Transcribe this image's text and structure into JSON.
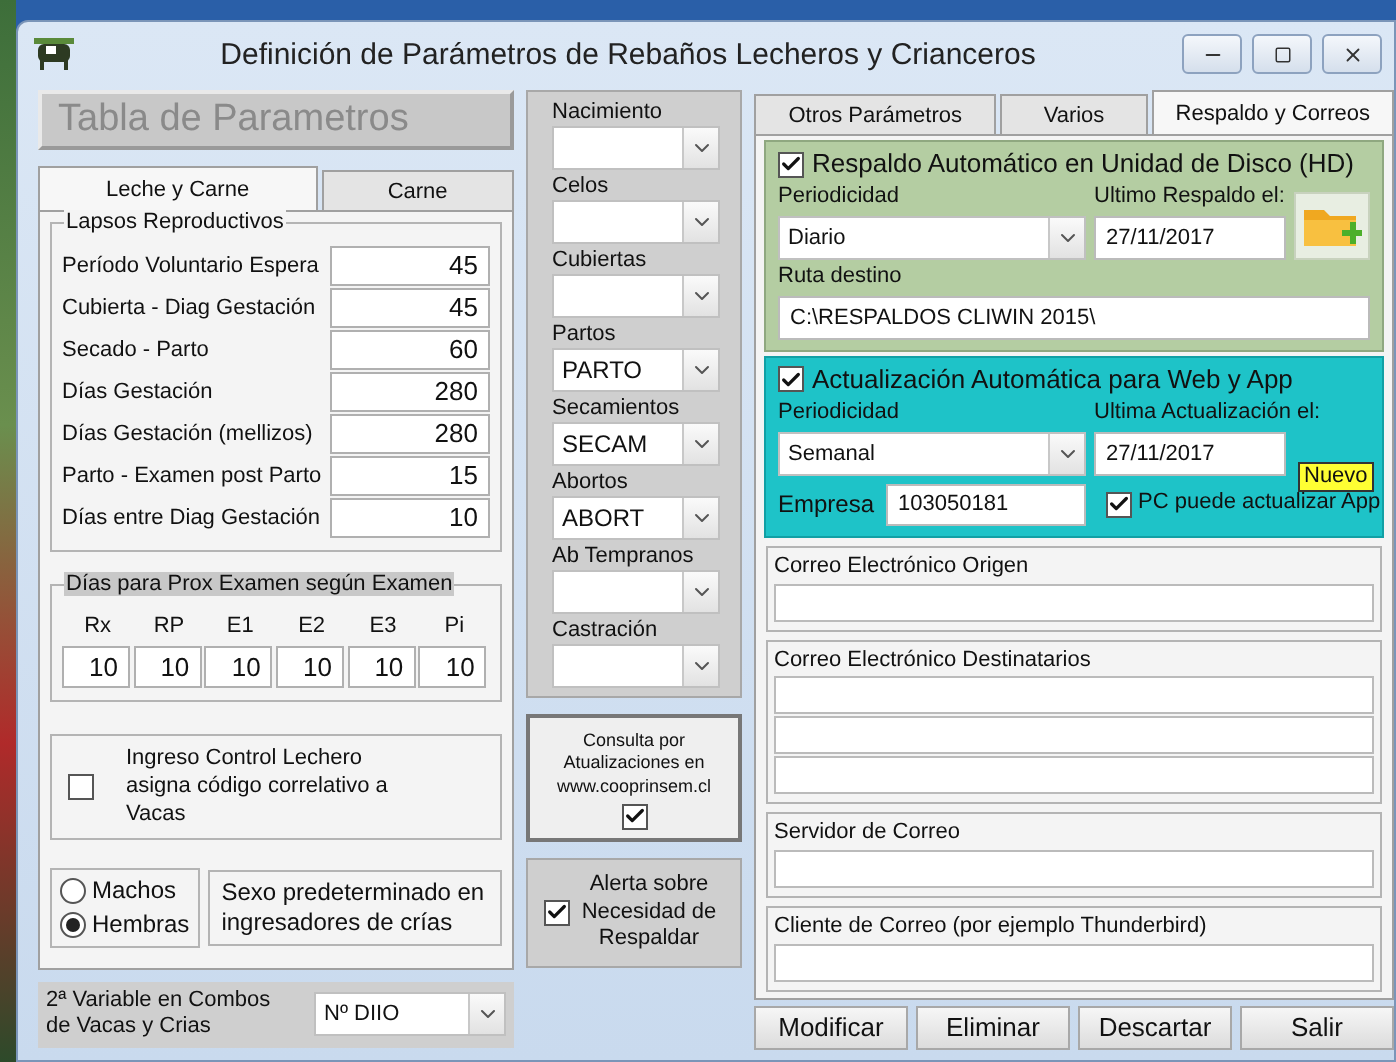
{
  "window": {
    "title": "Definición de Parámetros de Rebaños Lecheros y Crianceros"
  },
  "left": {
    "header": "Tabla de Parametros",
    "tabs": [
      {
        "label": "Leche y Carne",
        "selected": true
      },
      {
        "label": "Carne",
        "selected": false
      }
    ],
    "lapsos": {
      "title": "Lapsos Reproductivos",
      "rows": [
        {
          "label": "Período Voluntario Espera",
          "value": "45"
        },
        {
          "label": "Cubierta - Diag Gestación",
          "value": "45"
        },
        {
          "label": "Secado - Parto",
          "value": "60"
        },
        {
          "label": "Días Gestación",
          "value": "280"
        },
        {
          "label": "Días Gestación (mellizos)",
          "value": "280"
        },
        {
          "label": "Parto - Examen post Parto",
          "value": "15"
        },
        {
          "label": "Días entre Diag Gestación",
          "value": "10"
        }
      ]
    },
    "examen": {
      "title": "Días para Prox Examen según Examen",
      "columns": [
        {
          "label": "Rx",
          "value": "10"
        },
        {
          "label": "RP",
          "value": "10"
        },
        {
          "label": "E1",
          "value": "10"
        },
        {
          "label": "E2",
          "value": "10"
        },
        {
          "label": "E3",
          "value": "10"
        },
        {
          "label": "Pi",
          "value": "10"
        }
      ]
    },
    "ingreso": {
      "label": "Ingreso Control Lechero asigna código correlativo a Vacas",
      "checked": false
    },
    "sexo": {
      "options": [
        {
          "label": "Machos",
          "selected": false
        },
        {
          "label": "Hembras",
          "selected": true
        }
      ],
      "note": "Sexo predeterminado en ingresadores de crías"
    },
    "variable": {
      "label": "2ª Variable en Combos de Vacas y Crias",
      "value": "Nº DIIO"
    }
  },
  "middle": {
    "combos": [
      {
        "label": "Nacimiento"
      },
      {
        "label": "Celos"
      },
      {
        "label": "Cubiertas"
      },
      {
        "label": "Partos",
        "value": "PARTO"
      },
      {
        "label": "Secamientos",
        "value": "SECAM"
      },
      {
        "label": "Abortos",
        "value": "ABORT"
      },
      {
        "label": "Ab Tempranos"
      },
      {
        "label": "Castración"
      }
    ],
    "consulta": {
      "label": "Consulta por Atualizaciones en www.cooprinsem.cl",
      "checked": true
    },
    "alerta": {
      "label": "Alerta sobre Necesidad de Respaldar",
      "checked": true
    }
  },
  "right": {
    "tabs": [
      {
        "label": "Otros Parámetros",
        "selected": false
      },
      {
        "label": "Varios",
        "selected": false
      },
      {
        "label": "Respaldo y Correos",
        "selected": true
      }
    ],
    "backup": {
      "title": "Respaldo Automático en Unidad de Disco (HD)",
      "checked": true,
      "period_label": "Periodicidad",
      "period": "Diario",
      "last_label": "Ultimo Respaldo el:",
      "last": "27/11/2017",
      "path_label": "Ruta destino",
      "path": "C:\\RESPALDOS CLIWIN 2015\\"
    },
    "update": {
      "title": "Actualización Automática para Web y App",
      "checked": true,
      "period_label": "Periodicidad",
      "period": "Semanal",
      "last_label": "Ultima Actualización el:",
      "last": "27/11/2017",
      "badge": "Nuevo",
      "empresa_label": "Empresa",
      "empresa": "103050181",
      "pc": {
        "label": "PC puede actualizar App",
        "checked": true
      }
    },
    "mail": [
      {
        "label": "Correo Electrónico Origen",
        "kind": "single"
      },
      {
        "label": "Correo Electrónico Destinatarios",
        "kind": "triple"
      },
      {
        "label": "Servidor de Correo",
        "kind": "single"
      },
      {
        "label": "Cliente de Correo (por ejemplo Thunderbird)",
        "kind": "single"
      }
    ]
  },
  "buttons": [
    "Modificar",
    "Eliminar",
    "Descartar",
    "Salir"
  ]
}
